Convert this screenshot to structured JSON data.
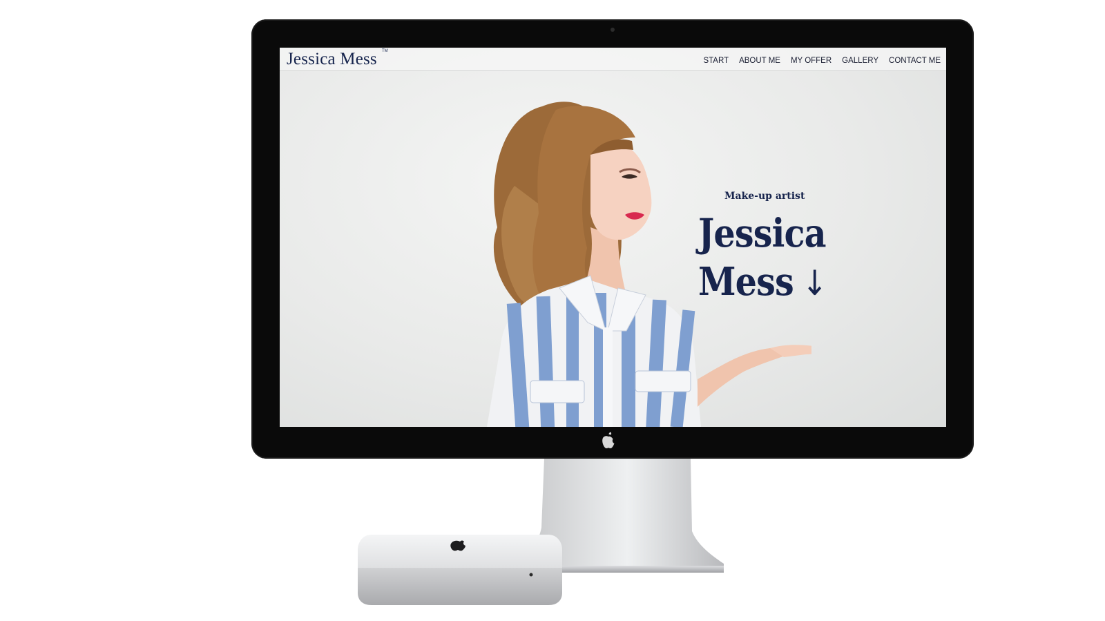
{
  "site": {
    "logo": "Jessica Mess",
    "logo_mark": "TM",
    "nav": [
      {
        "label": "START"
      },
      {
        "label": "ABOUT ME"
      },
      {
        "label": "MY OFFER"
      },
      {
        "label": "GALLERY"
      },
      {
        "label": "CONTACT ME"
      }
    ],
    "hero": {
      "subtitle": "Make-up artist",
      "title_line1": "Jessica",
      "title_line2": "Mess",
      "arrow": "↓"
    }
  },
  "colors": {
    "brand_navy": "#16244d",
    "bezel": "#0a0a0a",
    "screen_bg": "#ebeceb",
    "shirt_blue": "#7f9fd0",
    "hair": "#a8733f",
    "lips": "#d8294f"
  },
  "icons": {
    "apple": "apple-icon",
    "scroll_down": "arrow-down-icon"
  }
}
